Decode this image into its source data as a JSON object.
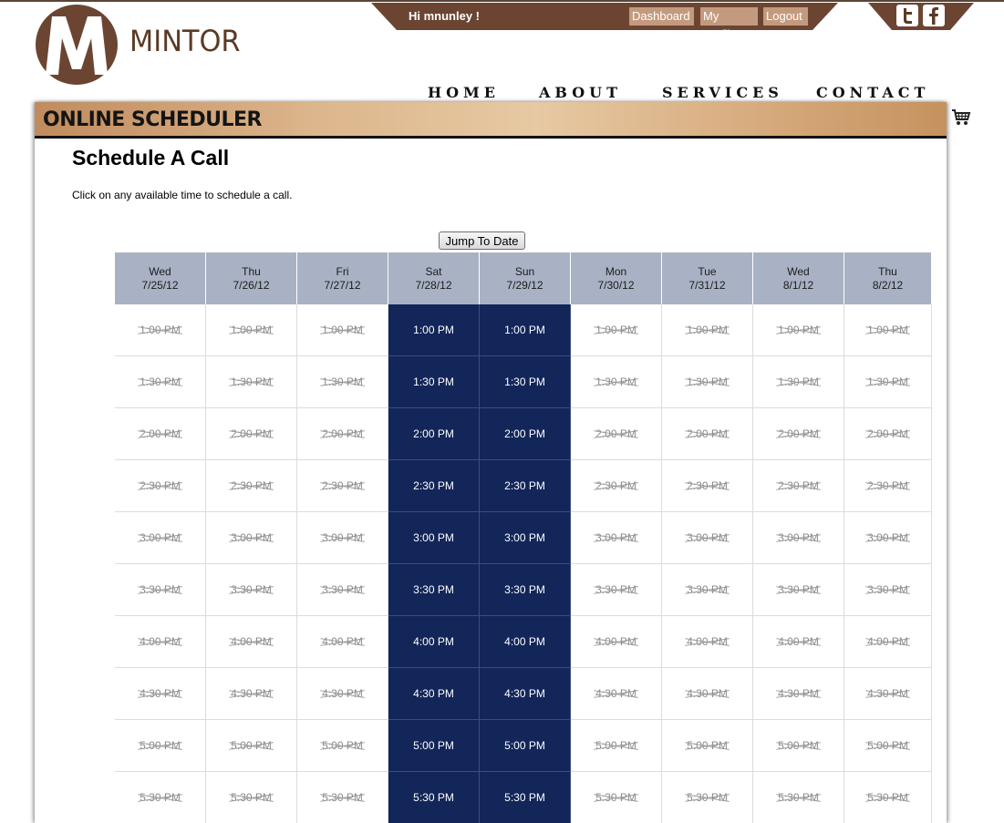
{
  "brand": {
    "name": "MINTOR",
    "logo_letter": "M"
  },
  "userbar": {
    "greeting": "Hi mnunley !",
    "dashboard_label": "Dashboard",
    "profile_label": "My Profile",
    "logout_label": "Logout"
  },
  "social": {
    "twitter_icon": "twitter-icon",
    "facebook_icon": "facebook-icon"
  },
  "nav": {
    "home": "HOME",
    "about": "ABOUT",
    "services": "SERVICES",
    "contact": "CONTACT"
  },
  "banner": {
    "title": "ONLINE SCHEDULER"
  },
  "page": {
    "heading": "Schedule A Call",
    "instruction": "Click on any available time to schedule a call.",
    "jump_button": "Jump To Date"
  },
  "colors": {
    "brand_brown": "#6b4532",
    "available_slot": "#13265a",
    "header_bg": "#a9b2c4"
  },
  "schedule": {
    "days": [
      {
        "day": "Wed",
        "date": "7/25/12",
        "available": false
      },
      {
        "day": "Thu",
        "date": "7/26/12",
        "available": false
      },
      {
        "day": "Fri",
        "date": "7/27/12",
        "available": false
      },
      {
        "day": "Sat",
        "date": "7/28/12",
        "available": true
      },
      {
        "day": "Sun",
        "date": "7/29/12",
        "available": true
      },
      {
        "day": "Mon",
        "date": "7/30/12",
        "available": false
      },
      {
        "day": "Tue",
        "date": "7/31/12",
        "available": false
      },
      {
        "day": "Wed",
        "date": "8/1/12",
        "available": false
      },
      {
        "day": "Thu",
        "date": "8/2/12",
        "available": false
      }
    ],
    "times": [
      "1:00 PM",
      "1:30 PM",
      "2:00 PM",
      "2:30 PM",
      "3:00 PM",
      "3:30 PM",
      "4:00 PM",
      "4:30 PM",
      "5:00 PM",
      "5:30 PM"
    ]
  }
}
